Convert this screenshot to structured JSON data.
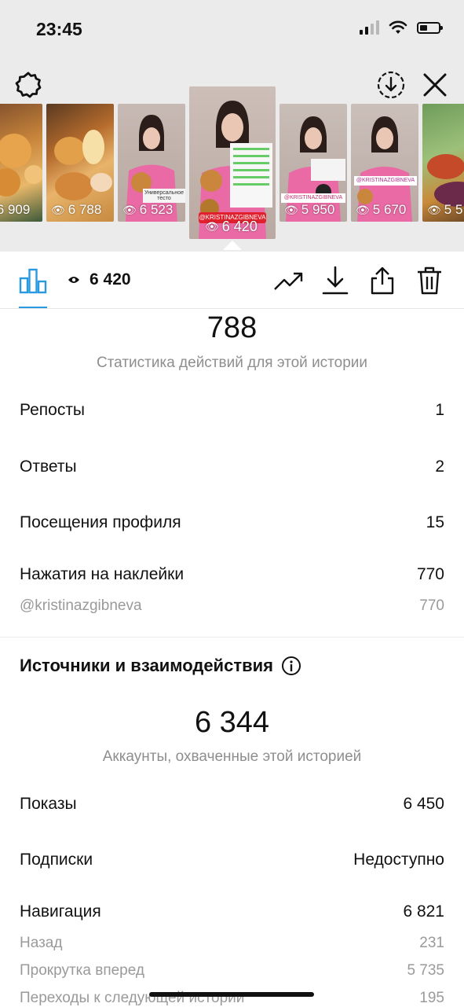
{
  "status_bar": {
    "time": "23:45"
  },
  "stories": [
    {
      "views": "6 909"
    },
    {
      "views": "6 788"
    },
    {
      "views": "6 523",
      "caption": "Универсальное тесто"
    },
    {
      "views": "6 420",
      "handle": "@KRISTINAZGIBNEVA",
      "active": true
    },
    {
      "views": "5 950",
      "handle": "@KRISTINAZGIBNEVA"
    },
    {
      "views": "5 670",
      "handle": "@KRISTINAZGIBNEVA"
    },
    {
      "views": "5 5"
    }
  ],
  "toolbar": {
    "views": "6 420"
  },
  "actions": {
    "total": "788",
    "caption": "Статистика действий для этой истории",
    "rows": [
      {
        "label": "Репосты",
        "value": "1"
      },
      {
        "label": "Ответы",
        "value": "2"
      },
      {
        "label": "Посещения профиля",
        "value": "15"
      },
      {
        "label": "Нажатия на наклейки",
        "value": "770"
      }
    ],
    "sticker_detail": {
      "label": "@kristinazgibneva",
      "value": "770"
    }
  },
  "discovery": {
    "title": "Источники и взаимодействия",
    "reach": "6 344",
    "reach_caption": "Аккаунты, охваченные этой историей",
    "impressions": {
      "label": "Показы",
      "value": "6 450"
    },
    "follows": {
      "label": "Подписки",
      "value": "Недоступно"
    },
    "navigation": {
      "label": "Навигация",
      "value": "6 821",
      "items": [
        {
          "label": "Назад",
          "value": "231"
        },
        {
          "label": "Прокрутка вперед",
          "value": "5 735"
        },
        {
          "label": "Переходы к следующей истории",
          "value": "195"
        }
      ]
    }
  },
  "colors": {
    "accent": "#2a9ae0",
    "secondary_text": "#8e8e8e",
    "top_background": "#ebebeb",
    "sticker_red": "#e0202c"
  }
}
